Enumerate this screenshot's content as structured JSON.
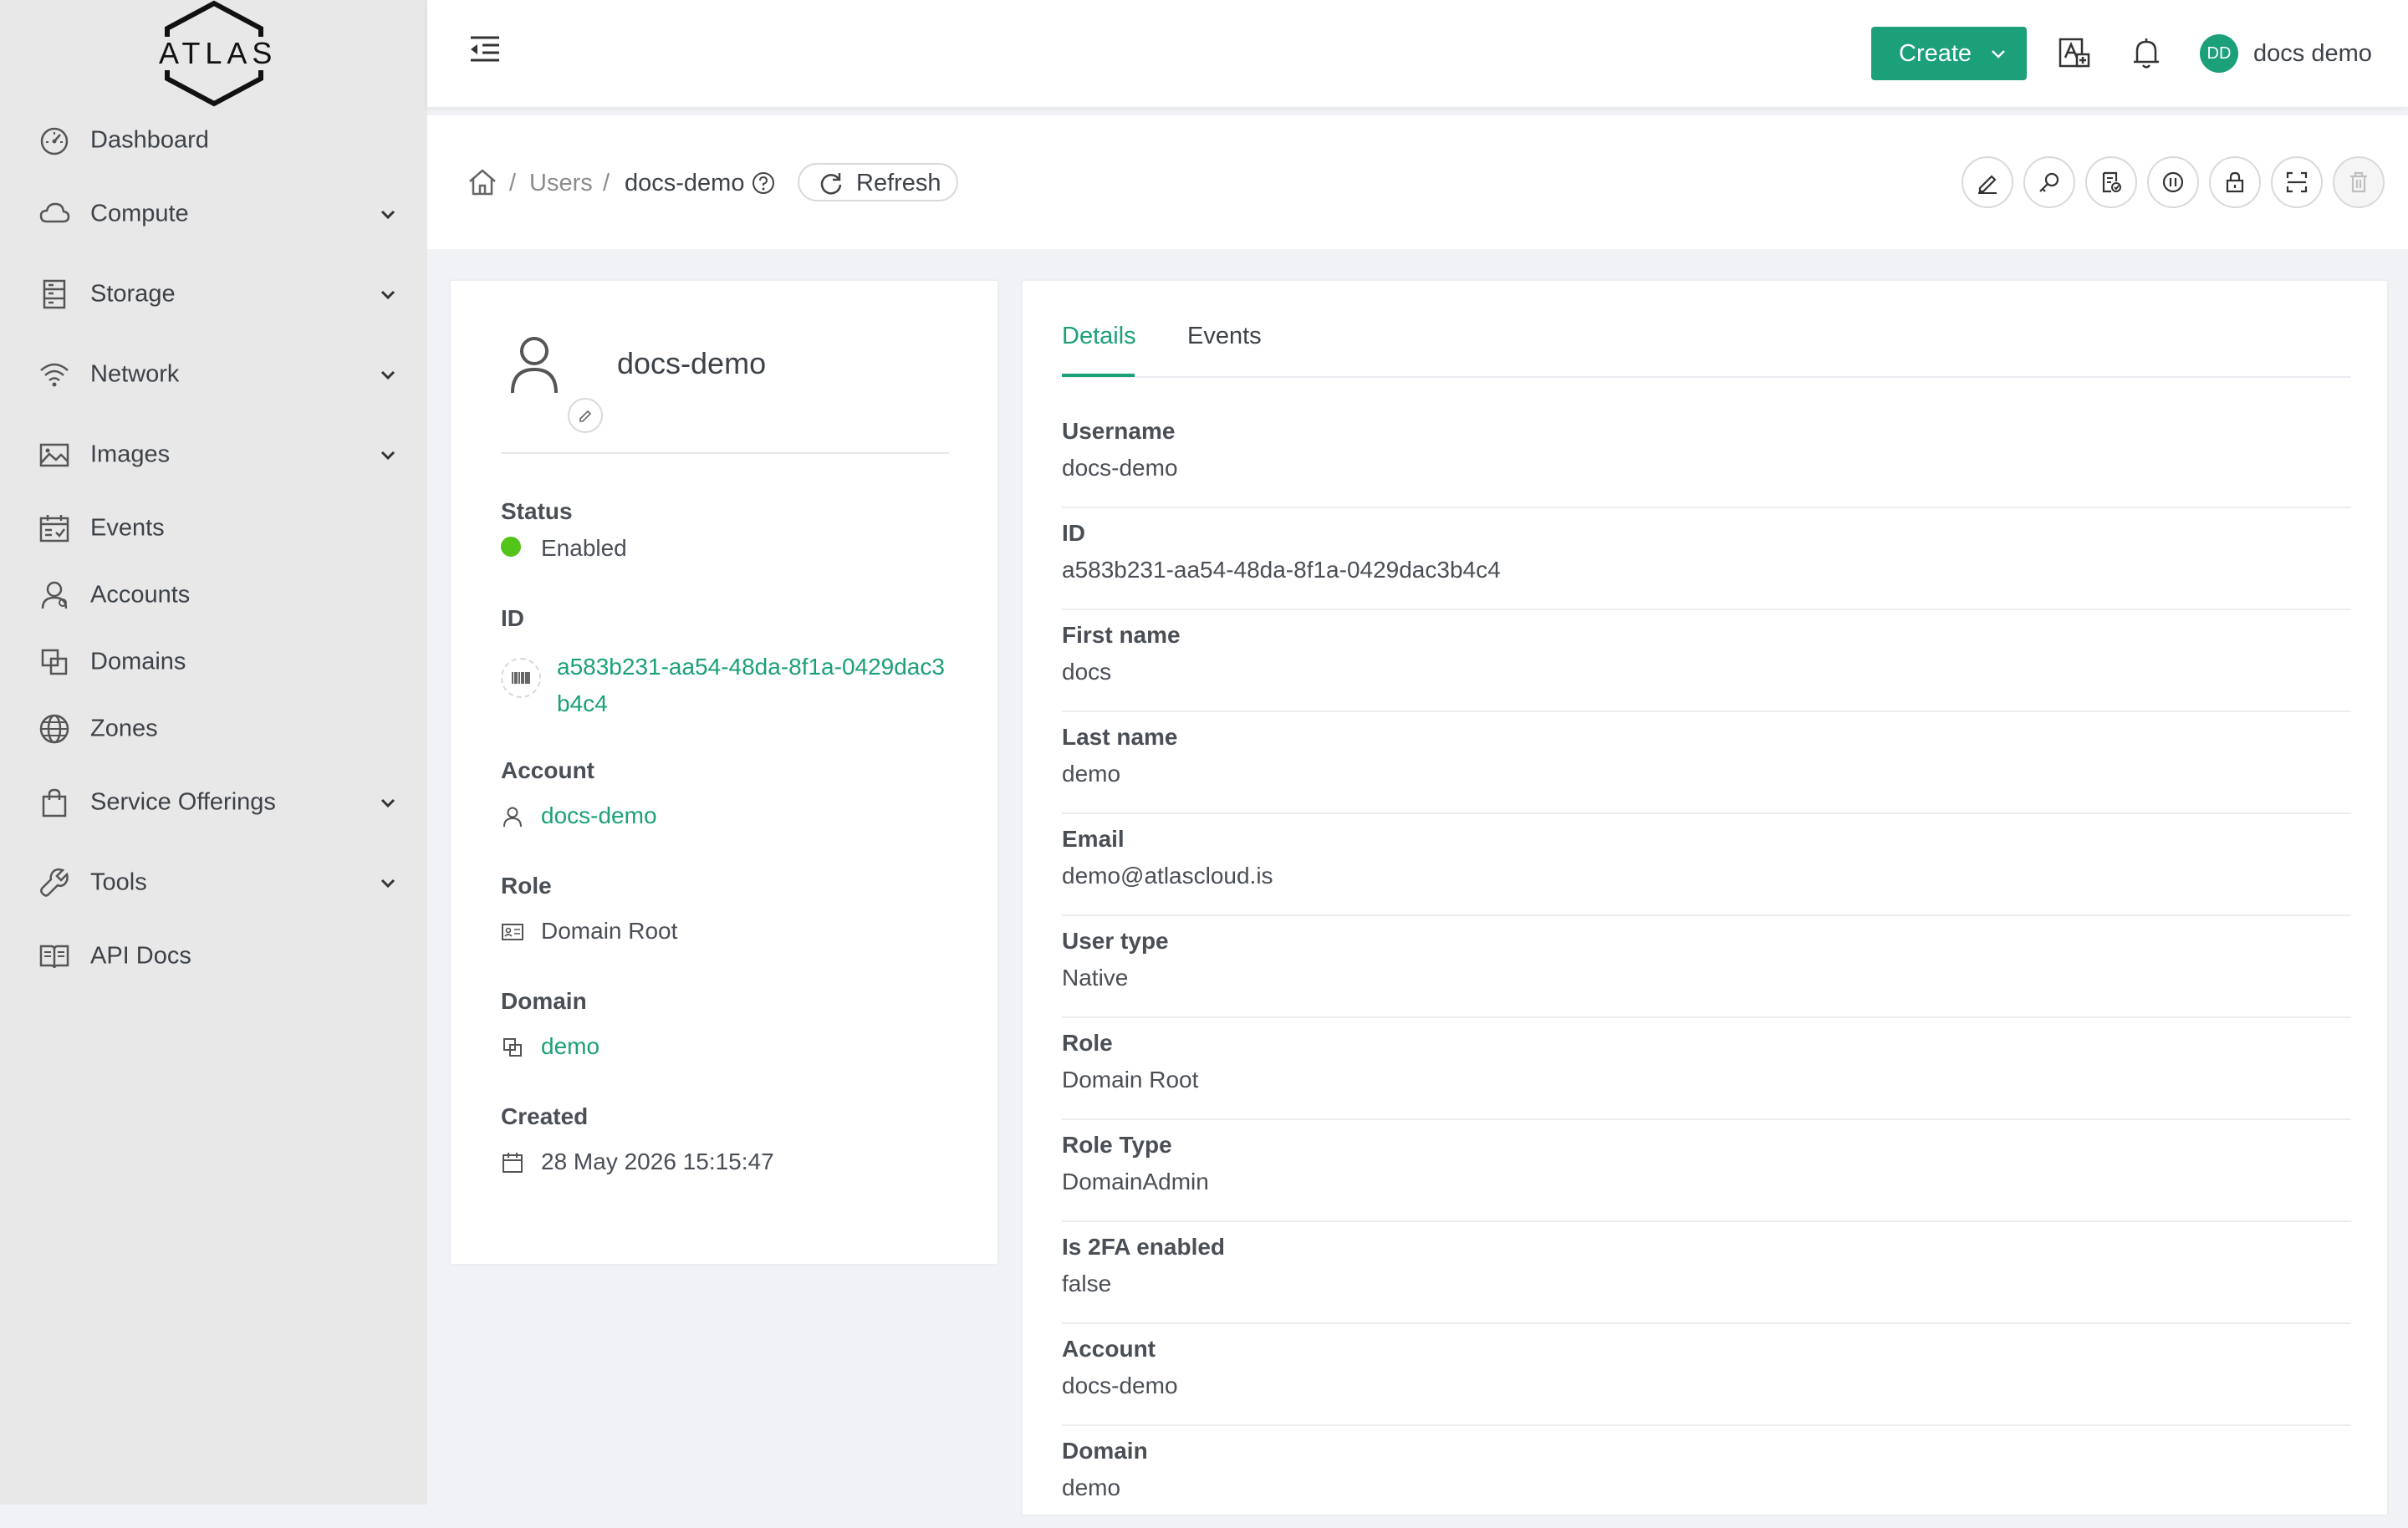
{
  "brand": {
    "logo_text": "ATLAS"
  },
  "sidebar": {
    "items": [
      {
        "label": "Dashboard",
        "icon": "dashboard-icon"
      },
      {
        "label": "Compute",
        "icon": "cloud-icon"
      },
      {
        "label": "Storage",
        "icon": "storage-icon"
      },
      {
        "label": "Network",
        "icon": "wifi-icon"
      },
      {
        "label": "Images",
        "icon": "picture-icon"
      },
      {
        "label": "Events",
        "icon": "schedule-icon"
      },
      {
        "label": "Accounts",
        "icon": "team-icon"
      },
      {
        "label": "Domains",
        "icon": "block-icon"
      },
      {
        "label": "Zones",
        "icon": "global-icon"
      },
      {
        "label": "Service Offerings",
        "icon": "shopping-icon"
      },
      {
        "label": "Tools",
        "icon": "tool-icon"
      },
      {
        "label": "API Docs",
        "icon": "read-icon"
      }
    ]
  },
  "header": {
    "create_label": "Create",
    "avatar_initials": "DD",
    "user_name": "docs demo"
  },
  "breadcrumb": {
    "items": [
      "Users",
      "docs-demo"
    ],
    "separator": "/",
    "refresh_label": "Refresh"
  },
  "profile": {
    "name": "docs-demo",
    "status_label": "Status",
    "status_value": "Enabled",
    "id_label": "ID",
    "id_value": "a583b231-aa54-48da-8f1a-0429dac3b4c4",
    "account_label": "Account",
    "account_value": "docs-demo",
    "role_label": "Role",
    "role_value": "Domain Root",
    "domain_label": "Domain",
    "domain_value": "demo",
    "created_label": "Created",
    "created_value": "28 May 2026 15:15:47"
  },
  "tabs": [
    "Details",
    "Events"
  ],
  "details": [
    {
      "label": "Username",
      "value": "docs-demo"
    },
    {
      "label": "ID",
      "value": "a583b231-aa54-48da-8f1a-0429dac3b4c4"
    },
    {
      "label": "First name",
      "value": "docs"
    },
    {
      "label": "Last name",
      "value": "demo"
    },
    {
      "label": "Email",
      "value": "demo@atlascloud.is"
    },
    {
      "label": "User type",
      "value": "Native"
    },
    {
      "label": "Role",
      "value": "Domain Root"
    },
    {
      "label": "Role Type",
      "value": "DomainAdmin"
    },
    {
      "label": "Is 2FA enabled",
      "value": "false"
    },
    {
      "label": "Account",
      "value": "docs-demo"
    },
    {
      "label": "Domain",
      "value": "demo"
    }
  ],
  "colors": {
    "accent": "#1ba07a",
    "status_enabled": "#52c41a",
    "sidebar_bg": "#e8e8e8"
  }
}
